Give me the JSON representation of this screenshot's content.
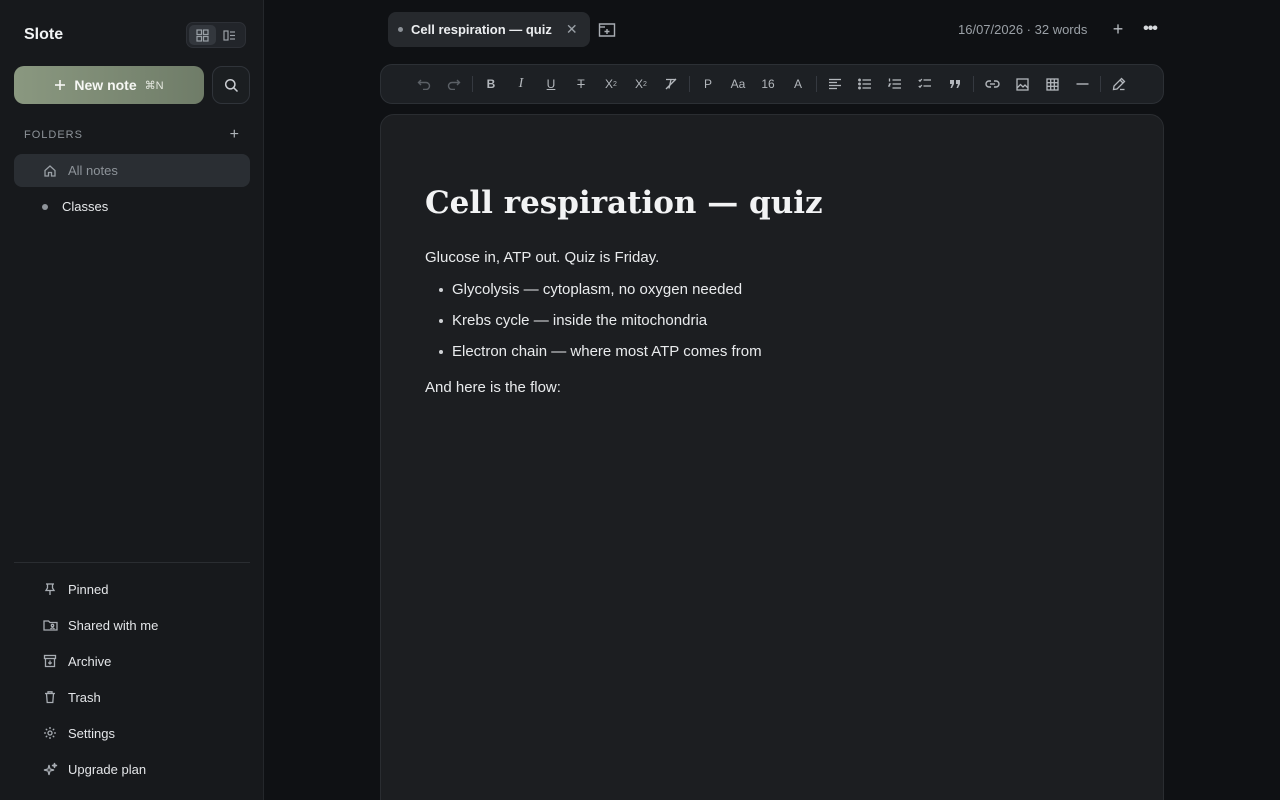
{
  "app": {
    "name": "Slote"
  },
  "sidebar": {
    "new_note_label": "New note",
    "new_note_shortcut": "⌘N",
    "folders_heading": "FOLDERS",
    "folders": [
      {
        "label": "All notes",
        "icon": "home-icon",
        "active": true
      },
      {
        "label": "Classes",
        "icon": "dot-icon",
        "active": false
      }
    ],
    "bottom_items": [
      {
        "label": "Pinned",
        "icon": "pin-icon"
      },
      {
        "label": "Shared with me",
        "icon": "shared-folder-icon"
      },
      {
        "label": "Archive",
        "icon": "archive-icon"
      },
      {
        "label": "Trash",
        "icon": "trash-icon"
      },
      {
        "label": "Settings",
        "icon": "gear-icon"
      },
      {
        "label": "Upgrade plan",
        "icon": "sparkle-icon"
      }
    ]
  },
  "topbar": {
    "tab_title": "Cell respiration — quiz",
    "meta": "16/07/2026 · 32 words"
  },
  "toolbar": {
    "paragraph_label": "P",
    "font_label": "Aa",
    "font_size": "16",
    "color_label": "A"
  },
  "document": {
    "title": "Cell respiration — quiz",
    "intro": "Glucose in, ATP out. Quiz is Friday.",
    "bullets": [
      "Glycolysis — cytoplasm, no oxygen needed",
      "Krebs cycle — inside the mitochondria",
      "Electron chain — where most ATP comes from"
    ],
    "outro": "And here is the flow:"
  },
  "colors": {
    "background": "#0f1114",
    "sidebar": "#17191c",
    "accent": "#7d8a75",
    "editor": "#1c1e21"
  }
}
